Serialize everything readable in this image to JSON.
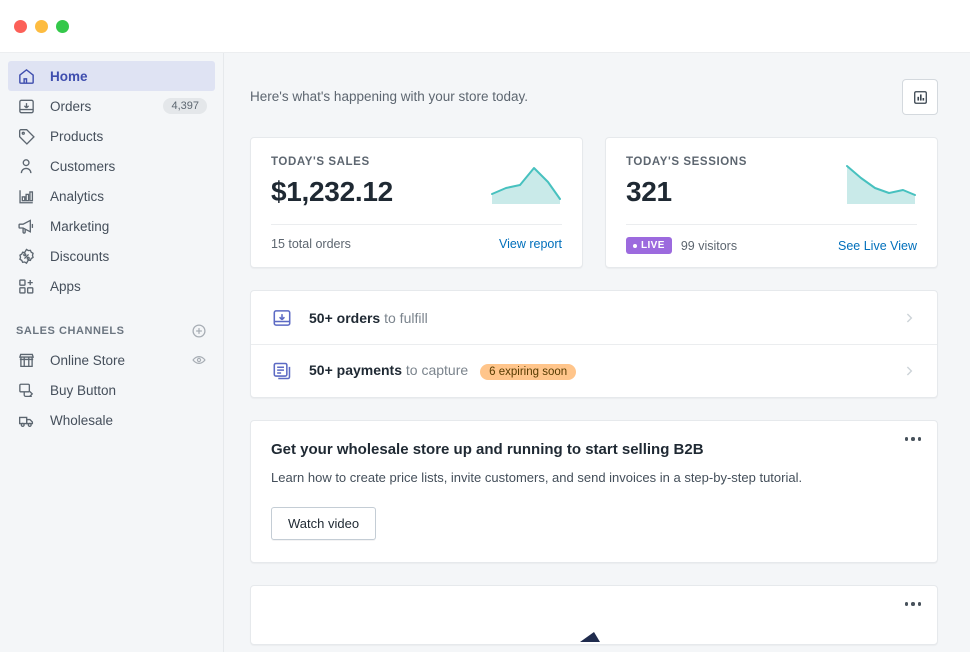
{
  "window": {
    "controls": [
      "close",
      "minimize",
      "maximize"
    ]
  },
  "sidebar": {
    "items": [
      {
        "label": "Home",
        "icon": "home-icon",
        "badge": "",
        "active": true
      },
      {
        "label": "Orders",
        "icon": "orders-icon",
        "badge": "4,397",
        "active": false
      },
      {
        "label": "Products",
        "icon": "products-icon",
        "badge": "",
        "active": false
      },
      {
        "label": "Customers",
        "icon": "customers-icon",
        "badge": "",
        "active": false
      },
      {
        "label": "Analytics",
        "icon": "analytics-icon",
        "badge": "",
        "active": false
      },
      {
        "label": "Marketing",
        "icon": "marketing-icon",
        "badge": "",
        "active": false
      },
      {
        "label": "Discounts",
        "icon": "discounts-icon",
        "badge": "",
        "active": false
      },
      {
        "label": "Apps",
        "icon": "apps-icon",
        "badge": "",
        "active": false
      }
    ],
    "section_title": "SALES CHANNELS",
    "add_channel_icon": "plus-circle-icon",
    "channels": [
      {
        "label": "Online Store",
        "icon": "store-icon",
        "action_icon": "eye-icon"
      },
      {
        "label": "Buy Button",
        "icon": "buy-button-icon",
        "action_icon": ""
      },
      {
        "label": "Wholesale",
        "icon": "wholesale-icon",
        "action_icon": ""
      }
    ]
  },
  "header": {
    "greeting": "Here's what's happening with your store today.",
    "chart_button_icon": "bar-chart-icon"
  },
  "stats": [
    {
      "title": "TODAY'S SALES",
      "value": "$1,232.12",
      "subtext": "15 total orders",
      "link": "View report",
      "badge": "",
      "spark_color": "#47c1bf"
    },
    {
      "title": "TODAY'S SESSIONS",
      "value": "321",
      "subtext": "99 visitors",
      "link": "See Live View",
      "badge": "LIVE",
      "spark_color": "#47c1bf"
    }
  ],
  "tasks": [
    {
      "icon": "orders-icon",
      "bold": "50+ orders",
      "rest": " to fulfill",
      "pill": "",
      "chevron": "chevron-right-icon"
    },
    {
      "icon": "payments-icon",
      "bold": "50+ payments",
      "rest": " to capture",
      "pill": "6 expiring soon",
      "chevron": "chevron-right-icon"
    }
  ],
  "promo": {
    "title": "Get your wholesale store up and running to start selling B2B",
    "subtitle": "Learn how to create price lists, invite customers, and send invoices in a step-by-step tutorial.",
    "button": "Watch video",
    "menu_icon": "kebab-menu-icon"
  },
  "partial_card": {
    "menu_icon": "kebab-menu-icon"
  },
  "colors": {
    "accent": "#3f4eae",
    "link": "#006fbb",
    "teal": "#47c1bf",
    "purple": "#9c6ade",
    "orange": "#ffc58b",
    "background": "#f4f6f8"
  },
  "chart_data": [
    {
      "type": "area",
      "title": "TODAY'S SALES",
      "x": [
        0,
        1,
        2,
        3,
        4,
        5
      ],
      "values": [
        30,
        42,
        48,
        86,
        52,
        18
      ],
      "ylim": [
        0,
        100
      ],
      "grid": false,
      "legend": "none"
    },
    {
      "type": "area",
      "title": "TODAY'S SESSIONS",
      "x": [
        0,
        1,
        2,
        3,
        4,
        5
      ],
      "values": [
        92,
        66,
        44,
        34,
        40,
        30
      ],
      "ylim": [
        0,
        100
      ],
      "grid": false,
      "legend": "none"
    }
  ]
}
